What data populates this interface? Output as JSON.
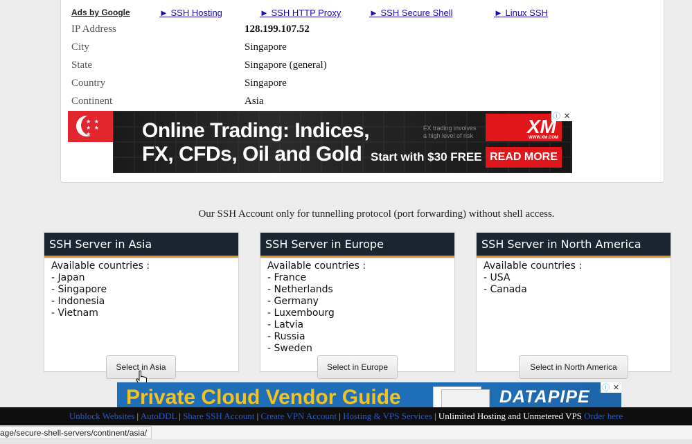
{
  "ads_bar": {
    "label": "Ads by Google",
    "links": [
      "► SSH Hosting",
      "► SSH HTTP Proxy",
      "► SSH Secure Shell",
      "► Linux SSH"
    ]
  },
  "ip_info": [
    {
      "label": "IP Address",
      "value": "128.199.107.52"
    },
    {
      "label": "City",
      "value": "Singapore"
    },
    {
      "label": "State",
      "value": "Singapore (general)"
    },
    {
      "label": "Country",
      "value": "Singapore"
    },
    {
      "label": "Continent",
      "value": "Asia"
    }
  ],
  "ad_banner_top": {
    "headline_1": "Online Trading: Indices,",
    "headline_2": "FX, CFDs, Oil and Gold",
    "risk_1": "FX trading involves",
    "risk_2": "a high level of risk",
    "cta_text": "Start with $30 FREE",
    "brand": "XM",
    "brand_sub": "WWW.XM.COM",
    "button": "READ MORE",
    "adchoice_icon": "info-close"
  },
  "notice": "Our SSH Account only for tunnelling protocol (port forwarding) without shell access.",
  "servers": [
    {
      "title": "SSH Server in Asia",
      "intro": "Available countries :",
      "countries": [
        "- Japan",
        "- Singapore",
        "- Indonesia",
        "- Vietnam"
      ],
      "button": "Select in Asia"
    },
    {
      "title": "SSH Server in Europe",
      "intro": "Available countries :",
      "countries": [
        "- France",
        "- Netherlands",
        "- Germany",
        "- Luxembourg",
        "- Latvia",
        "- Russia",
        "- Sweden"
      ],
      "button": "Select in Europe"
    },
    {
      "title": "SSH Server in North America",
      "intro": "Available countries :",
      "countries": [
        "- USA",
        "- Canada"
      ],
      "button": "Select in North America"
    }
  ],
  "ad_banner_bottom": {
    "headline": "Private Cloud Vendor Guide",
    "brand": "DATAPIPE"
  },
  "footer": {
    "links": [
      "Unblock Websites",
      "AutoDDL",
      "Share SSH Account",
      "Create VPN Account",
      "Hosting & VPS Services"
    ],
    "separator": "|",
    "plain": "Unlimited Hosting and Unmetered VPS",
    "order": "Order here"
  },
  "status_url": "age/secure-shell-servers/continent/asia/",
  "colors": {
    "card_header": "#1c2631",
    "card_accent": "#e8921e",
    "link": "#1a0dab",
    "ad_red": "#e0161b",
    "ad_blue": "#1f6fb8",
    "ad_yellow": "#f7c11d"
  }
}
